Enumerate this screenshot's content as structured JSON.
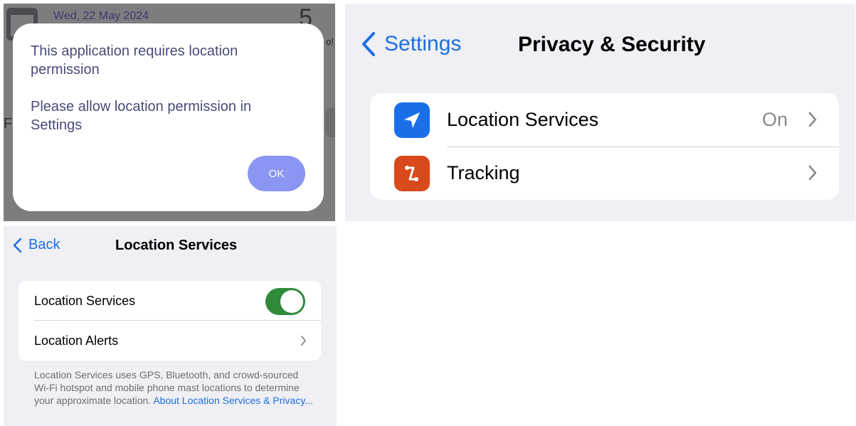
{
  "alert_panel": {
    "background": {
      "date": "Wed, 22 May 2024",
      "number": "5",
      "partial_text_right": "o!",
      "partial_text_left": "F"
    },
    "dialog": {
      "message_line1": "This application requires location permission",
      "message_line2": "Please allow location permission in Settings",
      "ok_label": "OK",
      "accent_color": "#8b96f3"
    }
  },
  "privacy_panel": {
    "nav": {
      "back_label": "Settings",
      "title": "Privacy & Security"
    },
    "rows": [
      {
        "label": "Location Services",
        "value": "On",
        "icon": "location-arrow-icon",
        "icon_color": "#1a6fe8"
      },
      {
        "label": "Tracking",
        "value": "",
        "icon": "tracking-icon",
        "icon_color": "#d84a1b"
      }
    ]
  },
  "location_panel": {
    "nav": {
      "back_label": "Back",
      "title": "Location Services"
    },
    "rows": [
      {
        "label": "Location Services",
        "toggle_on": true
      },
      {
        "label": "Location Alerts"
      }
    ],
    "footer_text": "Location Services uses GPS, Bluetooth, and crowd-sourced Wi-Fi hotspot and mobile phone mast locations to determine your approximate location.",
    "footer_link": "About Location Services & Privacy...",
    "toggle_color": "#2f8a3a",
    "link_color": "#1f6fe0"
  }
}
